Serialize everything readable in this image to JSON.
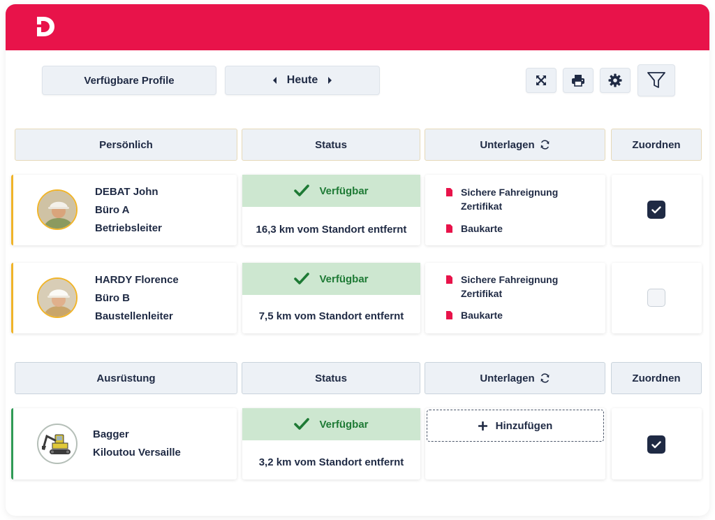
{
  "toolbar": {
    "profiles_label": "Verfügbare Profile",
    "date_label": "Heute",
    "icons": [
      "expand-icon",
      "print-icon",
      "gear-icon",
      "filter-icon"
    ]
  },
  "colors": {
    "brand": "#e8134a",
    "status_bg": "#cde7d0",
    "status_text": "#1e7a35",
    "person_accent": "#f0b429",
    "equipment_accent": "#2f9a55",
    "dark": "#1f2a44"
  },
  "people_section": {
    "headers": {
      "col1": "Persönlich",
      "col2": "Status",
      "col3": "Unterlagen",
      "col4": "Zuordnen"
    },
    "rows": [
      {
        "name": "DEBAT John",
        "office": "Büro A",
        "role": "Betriebsleiter",
        "status": "Verfügbar",
        "distance": "16,3 km vom Standort entfernt",
        "doc1_line1": "Sichere Fahreignung",
        "doc1_line2": "Zertifikat",
        "doc2": "Baukarte",
        "assigned": true
      },
      {
        "name": "HARDY Florence",
        "office": "Büro B",
        "role": "Baustellenleiter",
        "status": "Verfügbar",
        "distance": "7,5 km vom Standort entfernt",
        "doc1_line1": "Sichere Fahreignung",
        "doc1_line2": "Zertifikat",
        "doc2": "Baukarte",
        "assigned": false
      }
    ]
  },
  "equipment_section": {
    "headers": {
      "col1": "Ausrüstung",
      "col2": "Status",
      "col3": "Unterlagen",
      "col4": "Zuordnen"
    },
    "rows": [
      {
        "name": "Bagger",
        "supplier": "Kiloutou Versaille",
        "status": "Verfügbar",
        "distance": "3,2 km vom Standort entfernt",
        "add_label": "Hinzufügen",
        "assigned": true
      }
    ]
  }
}
